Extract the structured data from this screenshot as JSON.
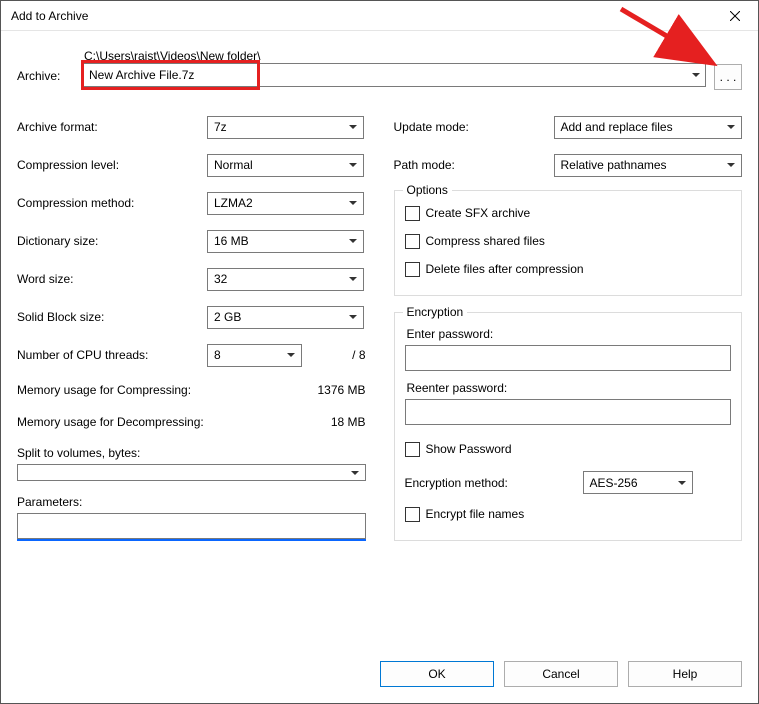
{
  "title": "Add to Archive",
  "archive": {
    "label": "Archive:",
    "path": "C:\\Users\\raist\\Videos\\New folder\\",
    "filename": "New Archive File.7z",
    "browse_label": ". . ."
  },
  "left": {
    "format": {
      "label": "Archive format:",
      "value": "7z"
    },
    "level": {
      "label": "Compression level:",
      "value": "Normal"
    },
    "method": {
      "label": "Compression method:",
      "value": "LZMA2"
    },
    "dict": {
      "label": "Dictionary size:",
      "value": "16 MB"
    },
    "word": {
      "label": "Word size:",
      "value": "32"
    },
    "block": {
      "label": "Solid Block size:",
      "value": "2 GB"
    },
    "cpu": {
      "label": "Number of CPU threads:",
      "value": "8",
      "suffix": "/ 8"
    },
    "mem_comp": {
      "label": "Memory usage for Compressing:",
      "value": "1376 MB"
    },
    "mem_decomp": {
      "label": "Memory usage for Decompressing:",
      "value": "18 MB"
    },
    "split": {
      "label": "Split to volumes, bytes:"
    },
    "params": {
      "label": "Parameters:"
    }
  },
  "right": {
    "update": {
      "label": "Update mode:",
      "value": "Add and replace files"
    },
    "pathmode": {
      "label": "Path mode:",
      "value": "Relative pathnames"
    },
    "options": {
      "legend": "Options",
      "sfx": "Create SFX archive",
      "shared": "Compress shared files",
      "delete": "Delete files after compression"
    },
    "enc": {
      "legend": "Encryption",
      "enter": "Enter password:",
      "reenter": "Reenter password:",
      "show": "Show Password",
      "method_label": "Encryption method:",
      "method_value": "AES-256",
      "encrypt_names": "Encrypt file names"
    }
  },
  "footer": {
    "ok": "OK",
    "cancel": "Cancel",
    "help": "Help"
  }
}
